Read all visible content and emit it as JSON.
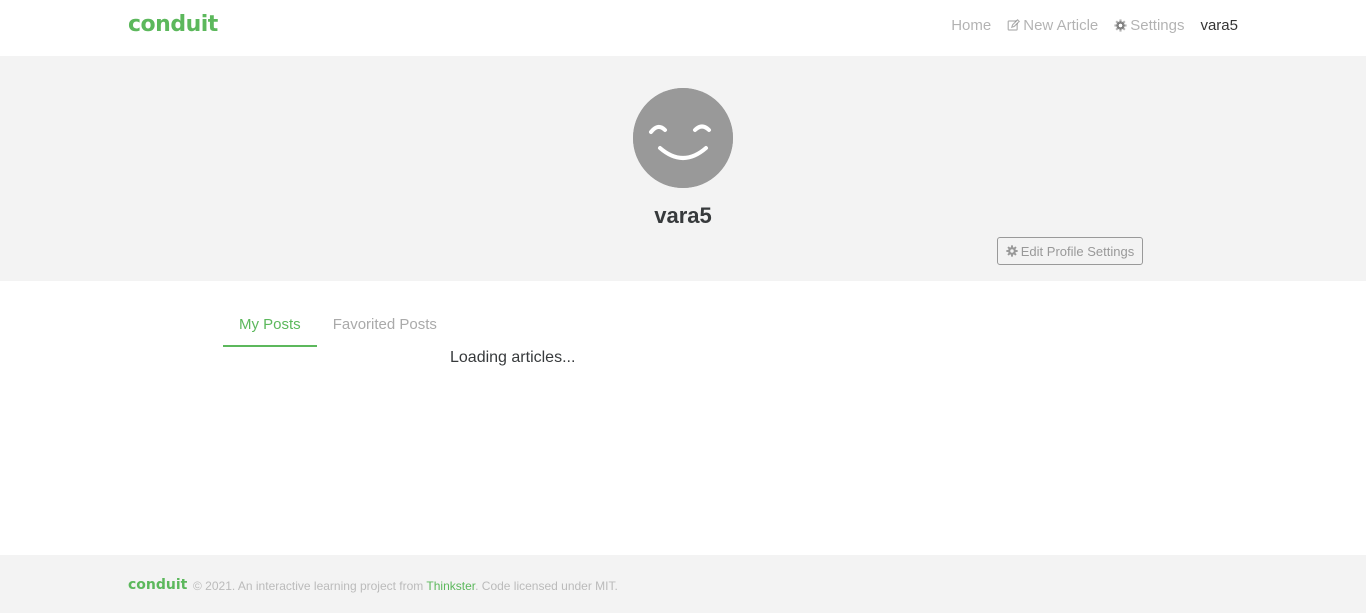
{
  "navbar": {
    "brand": "conduit",
    "links": [
      {
        "label": "Home",
        "icon": ""
      },
      {
        "label": "New Article",
        "icon": "edit-icon"
      },
      {
        "label": "Settings",
        "icon": "gear-icon"
      },
      {
        "label": "vara5",
        "icon": ""
      }
    ]
  },
  "profile": {
    "username": "vara5",
    "avatar": "smiley-avatar",
    "edit_button": "Edit Profile Settings"
  },
  "tabs": [
    {
      "label": "My Posts",
      "active": true
    },
    {
      "label": "Favorited Posts",
      "active": false
    }
  ],
  "status": "Loading articles...",
  "footer": {
    "brand": "conduit",
    "text_before": "© 2021. An interactive learning project from ",
    "link": "Thinkster",
    "text_after": ". Code licensed under MIT."
  },
  "colors": {
    "brand": "#5cb85c",
    "banner_bg": "#f3f3f3",
    "avatar_bg": "#999999"
  }
}
